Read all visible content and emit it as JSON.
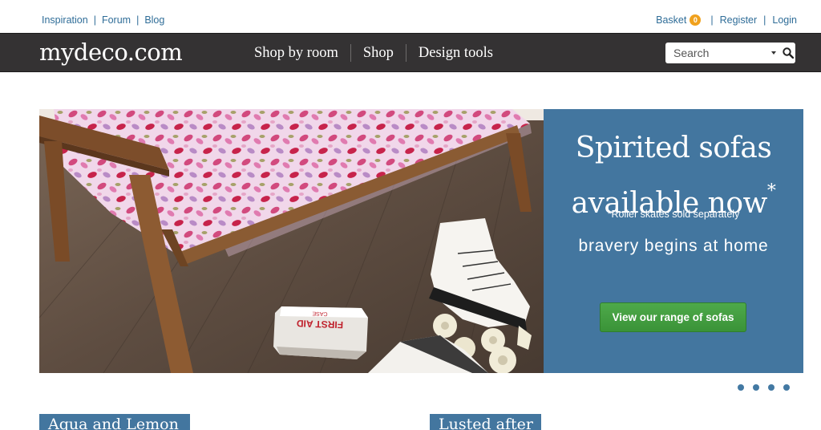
{
  "top_nav": {
    "links": [
      "Inspiration",
      "Forum",
      "Blog"
    ],
    "basket_label": "Basket",
    "basket_count": "0",
    "register_label": "Register",
    "login_label": "Login"
  },
  "header": {
    "logo": "mydeco.com",
    "nav_items": [
      "Shop by room",
      "Shop",
      "Design tools"
    ],
    "search_placeholder": "Search"
  },
  "hero": {
    "title_line1": "Spirited sofas",
    "title_line2": "available now",
    "title_asterisk": "*",
    "note": "*Roller skates sold separately",
    "tagline": "bravery begins at home",
    "cta_label": "View our range of sofas",
    "first_aid_text_line1": "FIRST AID",
    "first_aid_text_line2": "CASE",
    "panel_color": "#43769f",
    "cta_color": "#3f9d3c"
  },
  "carousel": {
    "dot_count": 4
  },
  "features": [
    {
      "label": "Aqua and Lemon"
    },
    {
      "label": "Lusted after"
    }
  ]
}
